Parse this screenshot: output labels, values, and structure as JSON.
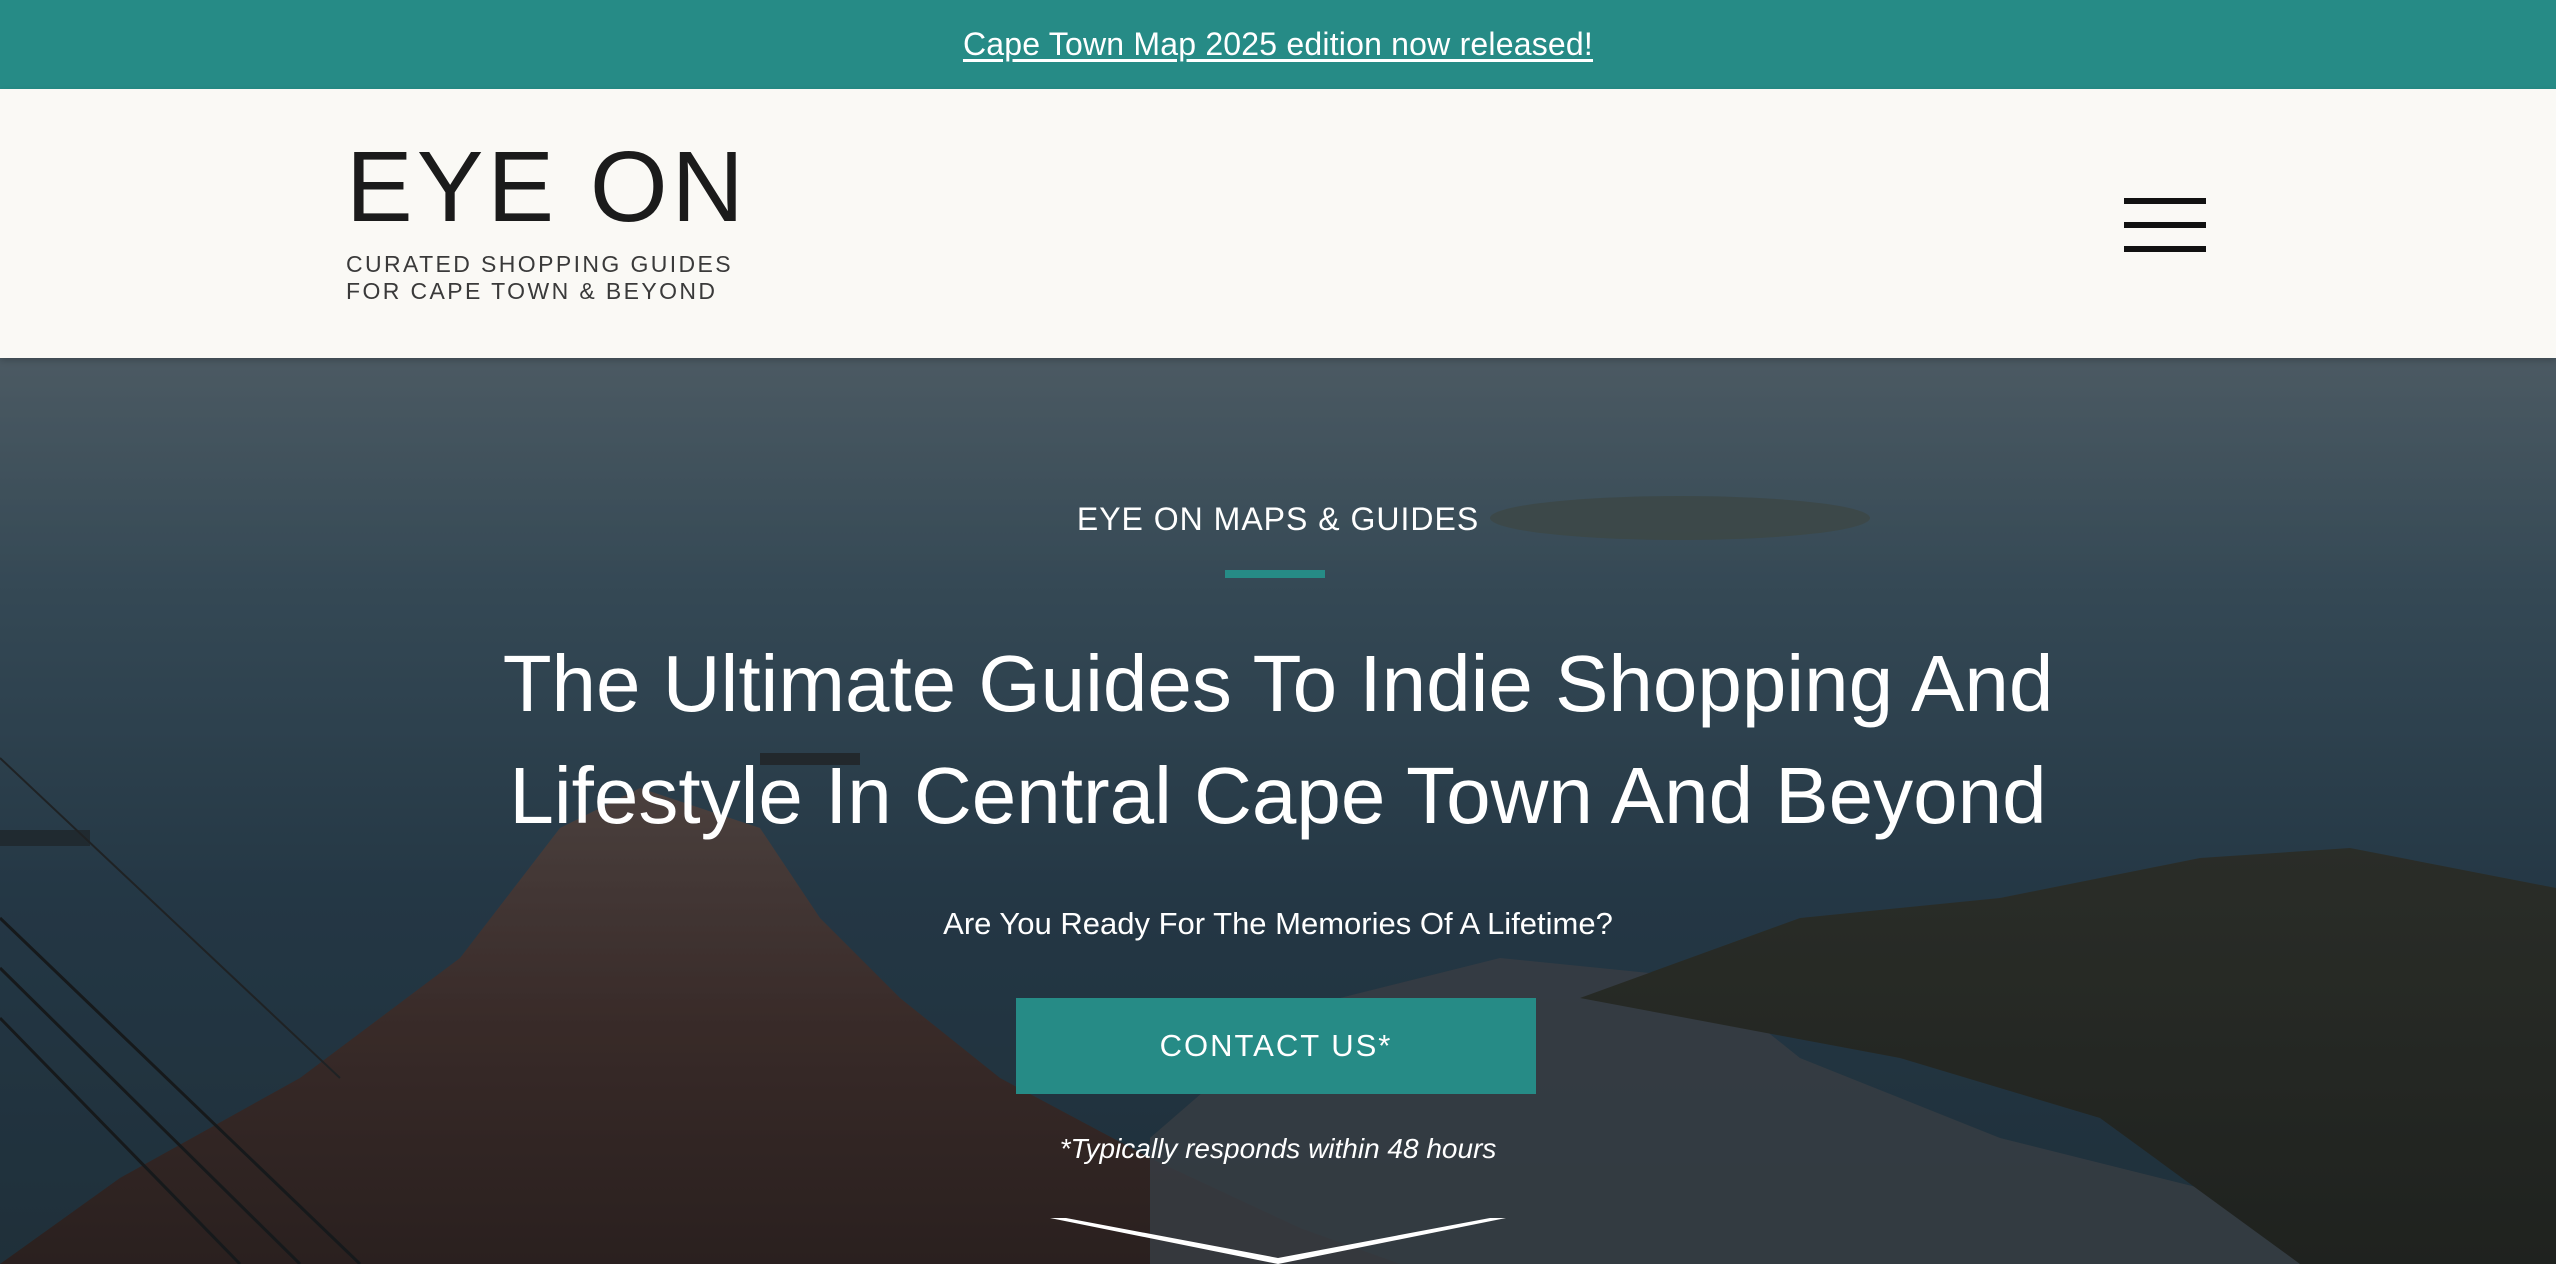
{
  "announcement": {
    "link_text": "Cape Town Map 2025 edition now released!"
  },
  "header": {
    "logo_title": "EYE ON",
    "logo_tagline_line1": "CURATED SHOPPING GUIDES",
    "logo_tagline_line2": "FOR CAPE TOWN & BEYOND",
    "menu_icon": "hamburger-menu-icon"
  },
  "hero": {
    "eyebrow": "EYE ON MAPS & GUIDES",
    "title": "The Ultimate Guides To Indie Shopping And Lifestyle In Central Cape Town And Beyond",
    "subtitle": "Are You Ready For The Memories Of A Lifetime?",
    "cta_label": "CONTACT US*",
    "cta_note": "*Typically responds within 48 hours",
    "scroll_icon": "chevron-down-icon"
  },
  "colors": {
    "accent": "#268b86",
    "header_bg": "#faf9f5",
    "text_dark": "#1b1b1b",
    "text_light": "#ffffff"
  }
}
